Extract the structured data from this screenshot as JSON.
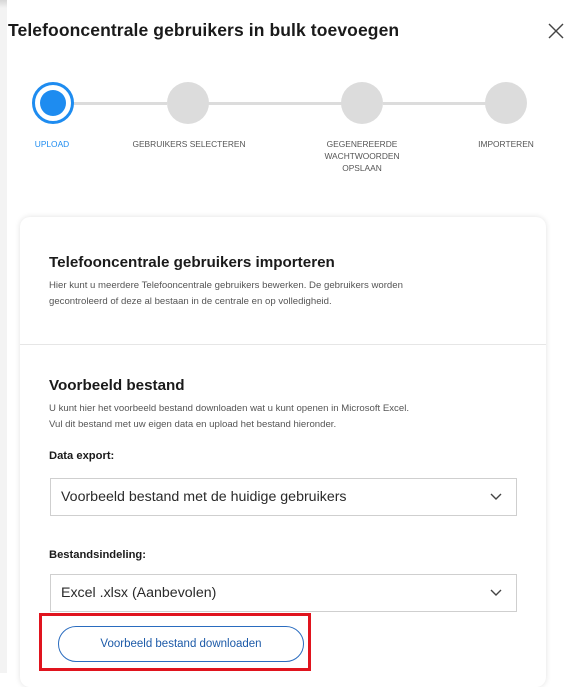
{
  "dialog": {
    "title": "Telefooncentrale gebruikers in bulk toevoegen",
    "close_icon": "close-icon"
  },
  "stepper": {
    "steps": [
      {
        "label": "UPLOAD",
        "active": true
      },
      {
        "label": "GEBRUIKERS SELECTEREN",
        "active": false
      },
      {
        "label_lines": [
          "GEGENEREERDE",
          "WACHTWOORDEN",
          "OPSLAAN"
        ],
        "active": false
      },
      {
        "label": "IMPORTEREN",
        "active": false
      }
    ],
    "active_color": "#1e8cf0",
    "inactive_color": "#dcdcdc"
  },
  "import_section": {
    "heading": "Telefooncentrale gebruikers importeren",
    "description_line1": "Hier kunt u meerdere Telefooncentrale gebruikers bewerken. De gebruikers worden",
    "description_line2": "gecontroleerd of deze al bestaan in de centrale en op volledigheid."
  },
  "example_section": {
    "heading": "Voorbeeld bestand",
    "description_line1": "U kunt hier het voorbeeld bestand downloaden wat u kunt openen in Microsoft Excel.",
    "description_line2": "Vul dit bestand met uw eigen data en upload het bestand hieronder.",
    "data_export_label": "Data export:",
    "data_export_value": "Voorbeeld bestand met de huidige gebruikers",
    "format_label": "Bestandsindeling:",
    "format_value": "Excel .xlsx (Aanbevolen)",
    "download_button": "Voorbeeld bestand downloaden"
  },
  "colors": {
    "highlight": "#e0141e",
    "button_border": "#2a6cbf"
  }
}
